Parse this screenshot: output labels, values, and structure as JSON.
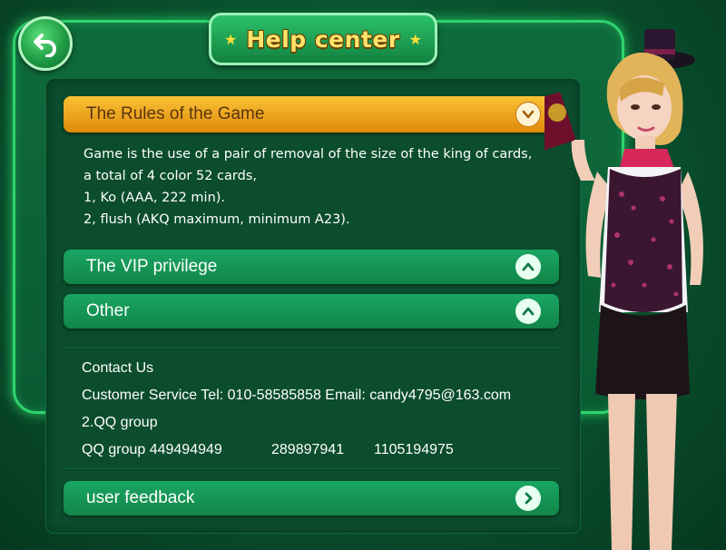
{
  "header": {
    "title": "Help center"
  },
  "sections": {
    "rules": {
      "label": "The Rules of the Game",
      "lines": [
        "Game is the use of a pair of removal of the size of the king of cards,",
        "a total of 4 color 52 cards,",
        "1, Ko (AAA, 222 min).",
        "2, flush (AKQ maximum, minimum A23)."
      ]
    },
    "vip": {
      "label": "The VIP privilege"
    },
    "other": {
      "label": "Other"
    }
  },
  "contact": {
    "title": "Contact Us",
    "service": "Customer Service Tel: 010-58585858 Email: candy4795@163.com",
    "qq_group_title": "2.QQ group",
    "qq_label": "QQ group 449494949",
    "qq_2": "289897941",
    "qq_3": "1105194975"
  },
  "feedback": {
    "label": "user feedback"
  },
  "icons": {
    "back": "back-arrow-icon",
    "rules": "chevron-down-icon",
    "vip": "chevron-up-icon",
    "other": "chevron-up-icon",
    "feedback": "chevron-right-icon"
  },
  "colors": {
    "background": "#0a5532",
    "frame_glow": "#2fd46e",
    "gold_header": "#f0a520",
    "green_header": "#16975a",
    "title_text": "#ffe46b"
  }
}
